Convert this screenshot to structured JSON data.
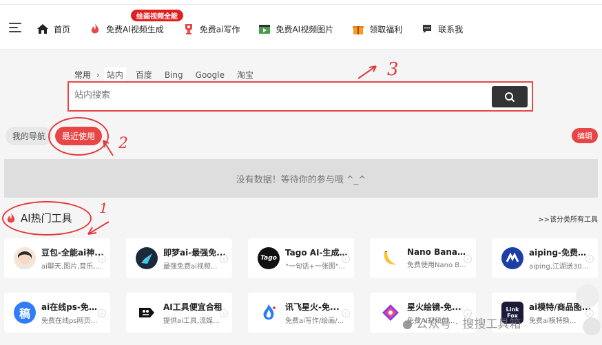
{
  "nav": {
    "items": [
      {
        "label": "首页",
        "icon": "home-icon",
        "color": "#222222"
      },
      {
        "label": "免费AI视频生成",
        "icon": "flame-icon",
        "color": "#e84545"
      },
      {
        "label": "免费ai写作",
        "icon": "trophy-icon",
        "color": "#e84545"
      },
      {
        "label": "免费AI视频图片",
        "icon": "film-icon",
        "color": "#3a8a3a"
      },
      {
        "label": "领取福利",
        "icon": "gift-icon",
        "color": "#f0a020"
      },
      {
        "label": "联系我",
        "icon": "chat-icon",
        "color": "#333333"
      }
    ],
    "badge": "绘画视频全能"
  },
  "search": {
    "lead": "常用",
    "tabs": [
      "站内",
      "百度",
      "Bing",
      "Google",
      "淘宝"
    ],
    "active_tab": "站内",
    "placeholder": "站内搜索"
  },
  "annotations": {
    "a1": "1",
    "a2": "2",
    "a3": "3"
  },
  "nav_tabs": {
    "mine": "我的导航",
    "recent": "最近使用",
    "edit": "编辑"
  },
  "empty_message": "没有数据！等待你的参与哦 ^_^",
  "section": {
    "title": "AI热门工具",
    "link": ">>该分类所有工具"
  },
  "tools_row1": [
    {
      "title": "豆包-全能ai神...",
      "desc": "ai聊天,图片,音乐,...",
      "icon_text": "",
      "icon_bg": "#f5d9c8"
    },
    {
      "title": "即梦ai-最强免...",
      "desc": "最强免费ai视频...",
      "icon_text": "",
      "icon_bg": "#1b2a3a"
    },
    {
      "title": "Tago AI-生成...",
      "desc": "\"一句话+一张图\"...",
      "icon_text": "Tago",
      "icon_bg": "#111111"
    },
    {
      "title": "Nano Banana...",
      "desc": "免费使用Nano B...",
      "icon_text": "",
      "icon_bg": "#ffffff"
    },
    {
      "title": "aiping-免费G...",
      "desc": "aiping,江湖送30...",
      "icon_text": "",
      "icon_bg": "#1d3fa8"
    }
  ],
  "tools_row2": [
    {
      "title": "ai在线ps-免费...",
      "desc": "免费在线ps网页...",
      "icon_text": "稿",
      "icon_bg": "#2f7df5"
    },
    {
      "title": "AI工具便宜合租",
      "desc": "提供ai工具,流媒...",
      "icon_text": "",
      "icon_bg": "#ffffff"
    },
    {
      "title": "讯飞星火-免...",
      "desc": "免费ai写作/绘画/...",
      "icon_text": "",
      "icon_bg": "#ffffff"
    },
    {
      "title": "星火绘镜-免...",
      "desc": "免费AI视频创...",
      "icon_text": "",
      "icon_bg": "#ffffff"
    },
    {
      "title": "ai模特/商品图...",
      "desc": "免费ai模特换...",
      "icon_text": "Link Fox",
      "icon_bg": "#1c1c3a"
    }
  ],
  "watermark": "公众号 · 搜搜工具箱"
}
